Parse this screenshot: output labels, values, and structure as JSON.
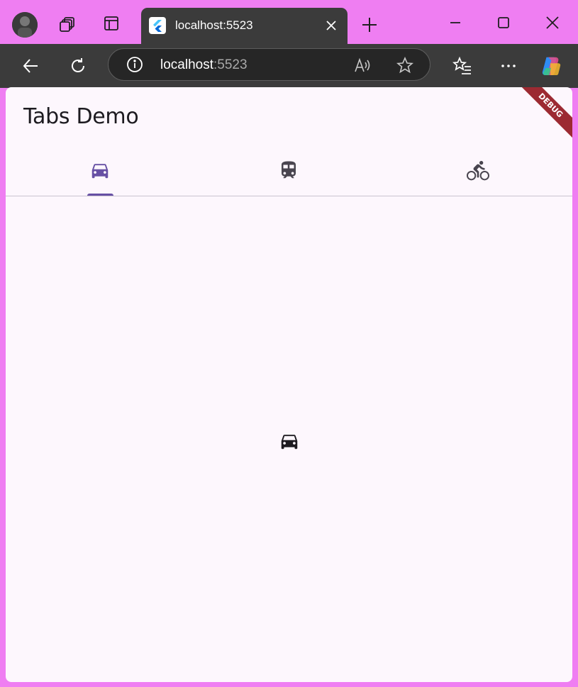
{
  "browser": {
    "tab": {
      "title": "localhost:5523"
    },
    "address": {
      "host": "localhost",
      "port": ":5523"
    }
  },
  "app": {
    "title": "Tabs Demo",
    "debug_banner": "DEBUG",
    "tabs": [
      {
        "icon": "car-icon",
        "selected": true
      },
      {
        "icon": "train-icon",
        "selected": false
      },
      {
        "icon": "bike-icon",
        "selected": false
      }
    ],
    "content_icon": "car-icon"
  },
  "colors": {
    "titlebar": "#ef7ef2",
    "toolbar": "#3b3b3b",
    "page_background": "#fdf7fd",
    "tab_selected": "#6750a4",
    "tab_unselected": "#49454f",
    "debug_banner": "#9c2a32"
  }
}
